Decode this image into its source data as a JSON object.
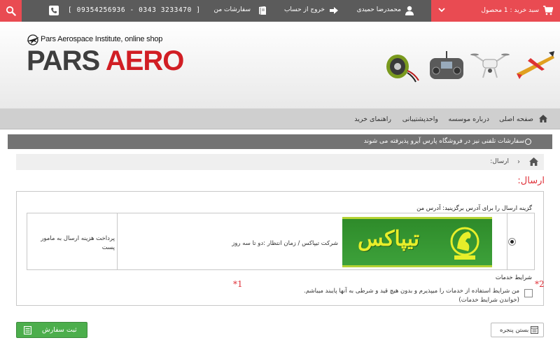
{
  "topbar": {
    "cart_label": "سبد خرید : 1 محصول",
    "user_name": "محمدرضا حمیدی",
    "logout": "خروج از حساب",
    "orders": "سفارشات من",
    "phones": "[ 09354256936 - 0343 3233470 ]",
    "icons": [
      "cart-icon",
      "chevron-down-icon",
      "user-icon",
      "logout-icon",
      "book-icon",
      "phone-icon",
      "search-icon"
    ]
  },
  "logo": {
    "subtitle": "Pars Aerospace Institute, online shop",
    "word1": "PARS",
    "word2": "AERO"
  },
  "nav": {
    "items": [
      "صفحه اصلی",
      "درباره موسسه",
      "واحدپشتیبانی",
      "راهنمای خرید"
    ]
  },
  "notice": "سفارشات تلفنی نیز در فروشگاه پارس آیرو پذیرفته می شوند",
  "breadcrumb": {
    "current": "ارسال:"
  },
  "page_title": "ارسال:",
  "shipping": {
    "choose_label": "گزینه ارسال را برای آدرس برگزینید: آدرس من",
    "logo_text": "تیپاکس",
    "description": "شرکت تیپاکس / زمان انتظار :دو تا سه روز",
    "cost_note": "پرداخت هزینه ارسال به مامور پست",
    "selected": true
  },
  "terms": {
    "title": "شرایط خدمات",
    "line1": "من شرایط استفاده از خدمات را میپذیرم و بدون هیچ قید و شرطی به آنها پایبند میباشم.",
    "line2": "(خواندن شرایط خدمات)",
    "mark1": "*1",
    "mark2": "*2",
    "checked": false
  },
  "buttons": {
    "submit": "ثبت سفارش",
    "close": "بستن پنجره"
  },
  "colors": {
    "accent": "#e94b52",
    "topbar": "#5b5b5b",
    "submit": "#4cae4c"
  }
}
